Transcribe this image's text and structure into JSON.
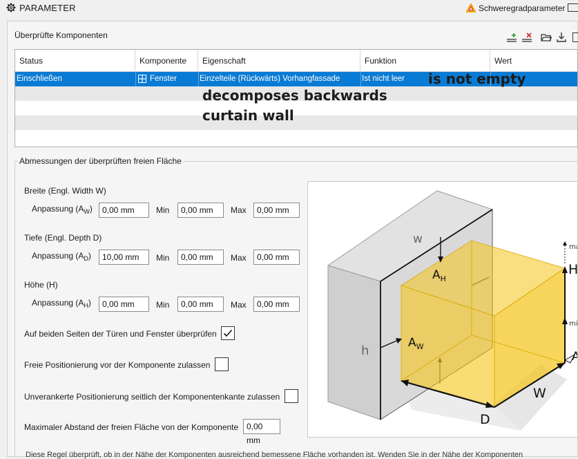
{
  "window": {
    "title": "PARAMETER",
    "severity_label": "Schweregradparameter",
    "severity_color": "#f4a300"
  },
  "components": {
    "title": "Überprüfte Komponenten",
    "toolbar_icons": [
      "add-row-icon",
      "delete-row-icon",
      "open-folder-icon",
      "download-icon"
    ],
    "columns": [
      "Status",
      "Komponente",
      "Eigenschaft",
      "Funktion",
      "Wert"
    ],
    "rows": [
      {
        "status": "Einschließen",
        "component": "Fenster",
        "property": "Einzelteile (Rückwärts) Vorhangfassade",
        "function": "Ist nicht leer",
        "value": ""
      }
    ],
    "annotations": {
      "function_translation": "is not empty",
      "property_translation_1": "decomposes backwards",
      "property_translation_2": "curtain wall"
    }
  },
  "dimensions": {
    "title": "Abmessungen der überprüften freien Fläche",
    "width": {
      "heading": "Breite (Engl. Width W)",
      "adjust_label": "Anpassung (A",
      "adjust_sub": "W",
      "adjust_value": "0,00 mm",
      "min_label": "Min",
      "min_value": "0,00 mm",
      "max_label": "Max",
      "max_value": "0,00 mm"
    },
    "depth": {
      "heading": "Tiefe (Engl. Depth D)",
      "adjust_label": "Anpassung (A",
      "adjust_sub": "D",
      "adjust_value": "10,00 mm",
      "min_label": "Min",
      "min_value": "0,00 mm",
      "max_label": "Max",
      "max_value": "0,00 mm"
    },
    "height": {
      "heading": "Höhe (H)",
      "adjust_label": "Anpassung (A",
      "adjust_sub": "H",
      "adjust_value": "0,00 mm",
      "min_label": "Min",
      "min_value": "0,00 mm",
      "max_label": "Max",
      "max_value": "0,00 mm"
    },
    "close_paren": ")",
    "check_both_sides": {
      "label": "Auf beiden Seiten der Türen und Fenster überprüfen",
      "checked": true
    },
    "free_positioning": {
      "label": "Freie Positionierung vor der Komponente zulassen",
      "checked": false
    },
    "unanchored_positioning": {
      "label": "Unverankerte Positionierung seitlich der Komponentenkante zulassen",
      "checked": false
    },
    "max_distance": {
      "label": "Maximaler Abstand der freien Fläche von der Komponente",
      "value": "0,00 mm"
    }
  },
  "diagram": {
    "labels": {
      "w": "w",
      "h": "h",
      "AH": "A",
      "AH_sub": "H",
      "AW": "A",
      "AW_sub": "W",
      "W": "W",
      "D": "D",
      "H": "H",
      "A_right": "A",
      "ma": "ma",
      "mi": "mi"
    },
    "volume_color": "#f5c518"
  },
  "footer": {
    "text": "Diese Regel überprüft, ob in der Nähe der Komponenten ausreichend bemessene Fläche vorhanden ist. Wenden Sie in der Nähe der Komponenten"
  }
}
